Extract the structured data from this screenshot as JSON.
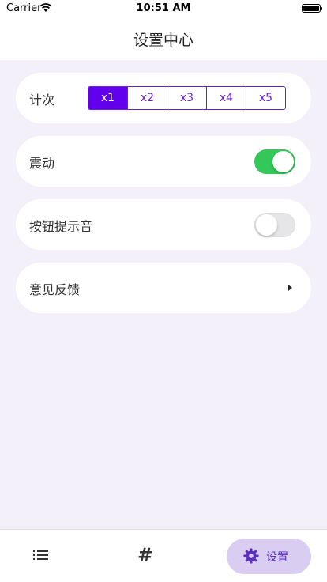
{
  "status_bar": {
    "carrier": "Carrier",
    "time": "10:51 AM"
  },
  "header": {
    "title": "设置中心"
  },
  "settings": {
    "count": {
      "label": "计次",
      "options": [
        "x1",
        "x2",
        "x3",
        "x4",
        "x5"
      ],
      "selected": "x1"
    },
    "vibration": {
      "label": "震动",
      "enabled": true
    },
    "button_sound": {
      "label": "按钮提示音",
      "enabled": false
    },
    "feedback": {
      "label": "意见反馈"
    }
  },
  "tabbar": {
    "settings_label": "设置",
    "hash_glyph": "#"
  },
  "colors": {
    "accent": "#6200ee",
    "toggle_on": "#34c759",
    "tab_active_bg": "#d9cef2",
    "background": "#f3f0f9"
  }
}
